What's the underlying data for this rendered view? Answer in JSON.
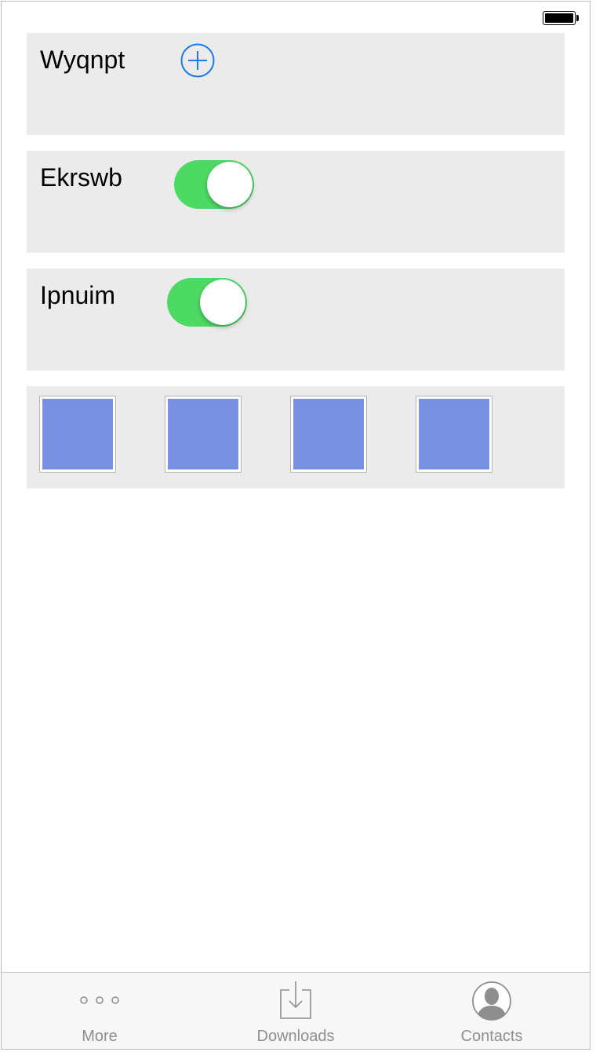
{
  "status_bar": {
    "battery_icon": "battery-full-icon"
  },
  "rows": [
    {
      "label": "Wyqnpt",
      "control": "add-button",
      "icon": "plus-circle-icon",
      "accent": "#1a7ae6"
    },
    {
      "label": "Ekrswb",
      "control": "toggle",
      "on": true,
      "color": "#4cd964"
    },
    {
      "label": "Ipnuim",
      "control": "toggle",
      "on": true,
      "color": "#4cd964"
    }
  ],
  "gallery": {
    "count": 4,
    "tile_color": "#7891e3"
  },
  "tabbar": {
    "tabs": [
      {
        "label": "More",
        "icon": "more-dots-icon"
      },
      {
        "label": "Downloads",
        "icon": "download-tray-icon"
      },
      {
        "label": "Contacts",
        "icon": "contact-avatar-icon"
      }
    ]
  }
}
